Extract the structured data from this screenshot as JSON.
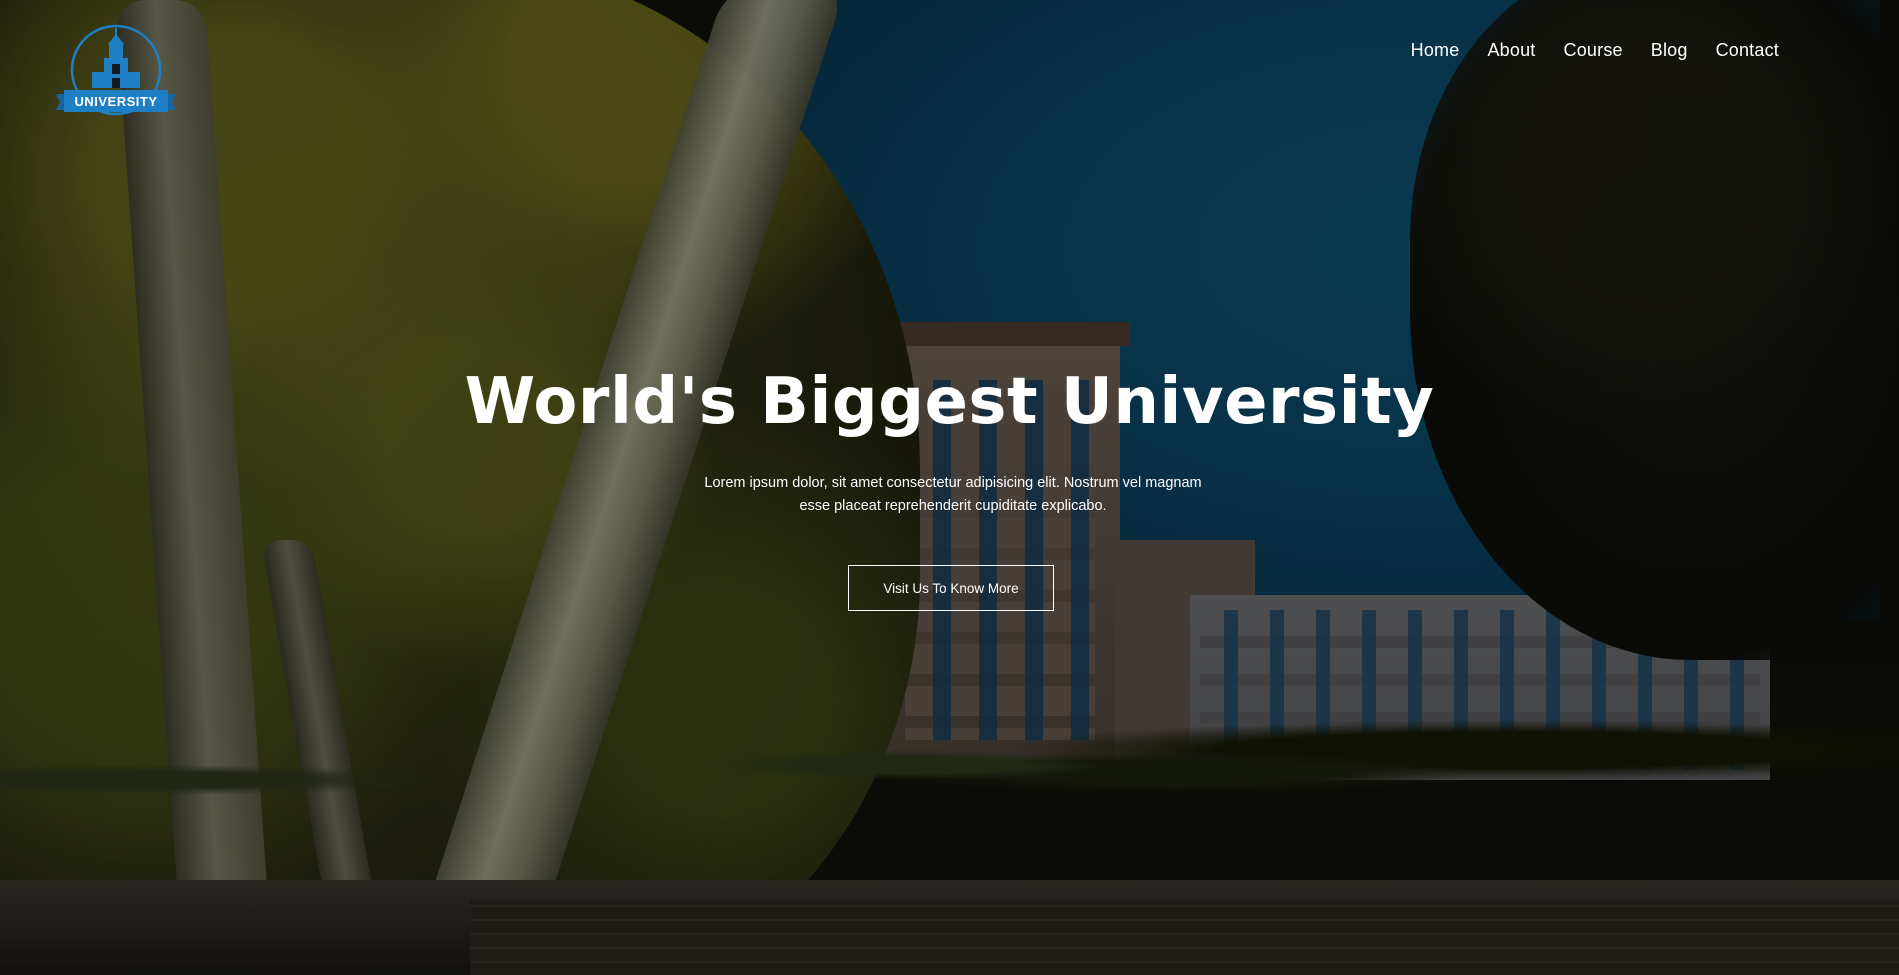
{
  "header": {
    "logo_text": "UNIVERSITY",
    "nav": [
      {
        "label": "Home"
      },
      {
        "label": "About"
      },
      {
        "label": "Course"
      },
      {
        "label": "Blog"
      },
      {
        "label": "Contact"
      }
    ]
  },
  "hero": {
    "title": "World's Biggest University",
    "subtitle_line1": "Lorem ipsum dolor, sit amet consectetur adipisicing elit. Nostrum vel magnam",
    "subtitle_line2": "esse placeat reprehenderit cupiditate explicabo.",
    "cta_label": "Visit Us To Know More"
  },
  "colors": {
    "logo_blue": "#1e7fc4",
    "text": "#ffffff",
    "sky": "#0b4564"
  }
}
